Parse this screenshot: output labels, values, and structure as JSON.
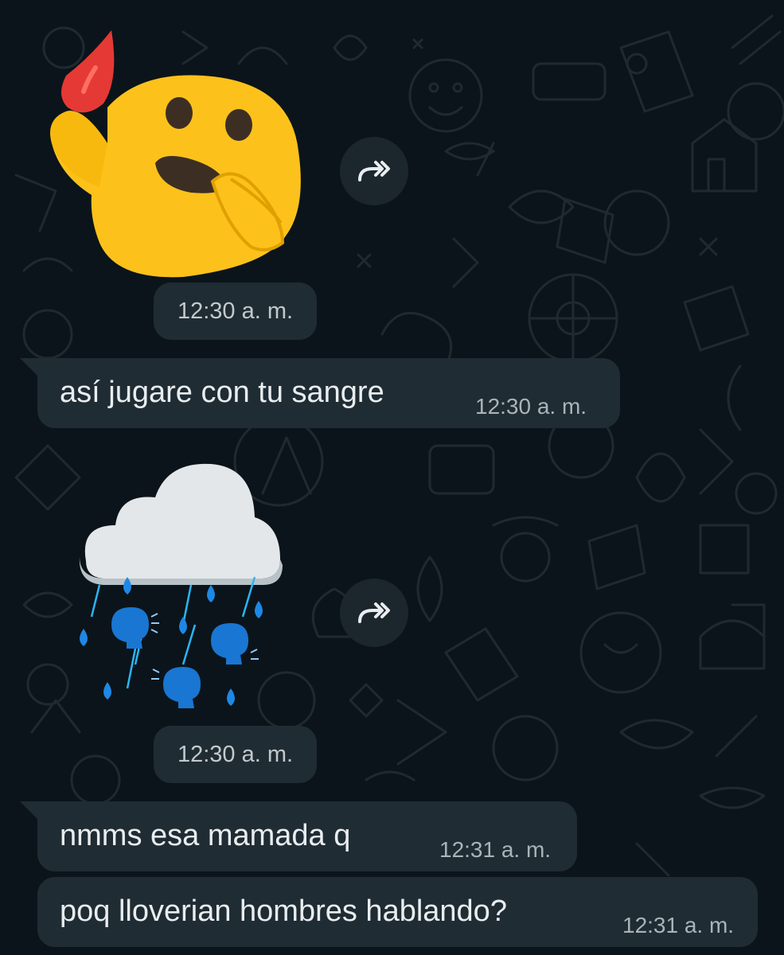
{
  "colors": {
    "background": "#0b141a",
    "bubble": "#202c33",
    "time_text": "#aab3b8"
  },
  "messages": [
    {
      "type": "sticker",
      "sticker": "hand-over-mouth-blood-drop-sticker",
      "time": "12:30 a. m.",
      "forward_icon": "forward-icon"
    },
    {
      "type": "text",
      "text": "así jugare con tu sangre",
      "time": "12:30 a. m."
    },
    {
      "type": "sticker",
      "sticker": "raining-speaking-heads-cloud-sticker",
      "time": "12:30 a. m.",
      "forward_icon": "forward-icon"
    },
    {
      "type": "text",
      "text": "nmms esa mamada q",
      "time": "12:31 a. m."
    },
    {
      "type": "text",
      "text": "poq lloverian hombres hablando?",
      "time": "12:31 a. m."
    }
  ]
}
